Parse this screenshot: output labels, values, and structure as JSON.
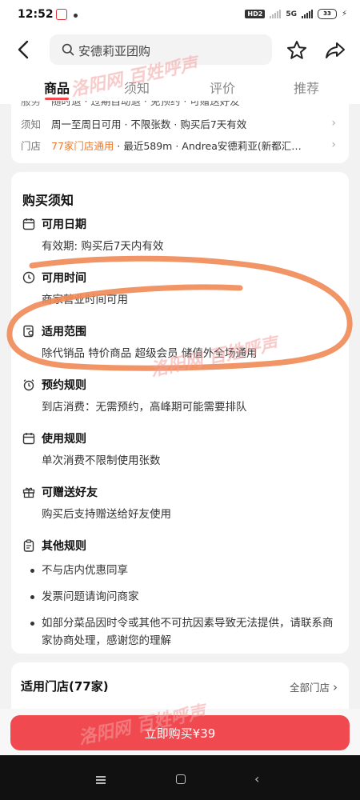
{
  "status_bar": {
    "time": "12:52",
    "hd": "HD2",
    "network": "5G",
    "battery": "33"
  },
  "header": {
    "search_text": "安德莉亚团购",
    "tabs": [
      {
        "label": "商品",
        "active": true
      },
      {
        "label": "须知",
        "active": false
      },
      {
        "label": "评价",
        "active": false
      },
      {
        "label": "推荐",
        "active": false
      }
    ]
  },
  "info": {
    "partial_row": {
      "label": "服务",
      "text": "随时退 · 过期自动退 · 免预约 · 可赠送好友"
    },
    "rows": [
      {
        "label": "须知",
        "text": "周一至周日可用 · 不限张数 · 购买后7天有效"
      },
      {
        "label": "门店",
        "highlight": "77家门店通用",
        "text": " · 最近589m · Andrea安德莉亚(新都汇…"
      }
    ]
  },
  "notice": {
    "title": "购买须知",
    "sections": [
      {
        "title": "可用日期",
        "icon": "calendar-icon",
        "body": "有效期: 购买后7天内有效"
      },
      {
        "title": "可用时间",
        "icon": "clock-icon",
        "body": "商家营业时间可用"
      },
      {
        "title": "适用范围",
        "icon": "scope-icon",
        "body": "除代销品 特价商品 超级会员 储值外全场通用"
      },
      {
        "title": "预约规则",
        "icon": "alarm-icon",
        "body": "到店消费：无需预约，高峰期可能需要排队"
      },
      {
        "title": "使用规则",
        "icon": "calendar-check-icon",
        "body": "单次消费不限制使用张数"
      },
      {
        "title": "可赠送好友",
        "icon": "gift-icon",
        "body": "购买后支持赠送给好友使用"
      },
      {
        "title": "其他规则",
        "icon": "clipboard-icon",
        "bullets": [
          "不与店内优惠同享",
          "发票问题请询问商家",
          "如部分菜品因时令或其他不可抗因素导致无法提供，请联系商家协商处理，感谢您的理解"
        ]
      }
    ]
  },
  "stores": {
    "title": "适用门店(77家)",
    "all_label": "全部门店"
  },
  "buy": {
    "label": "立即购买¥39"
  },
  "watermark": "洛阳网 百姓呼声",
  "colors": {
    "accent": "#f04a50",
    "highlight": "#ee7b2d",
    "annotation": "#ef8a55"
  }
}
